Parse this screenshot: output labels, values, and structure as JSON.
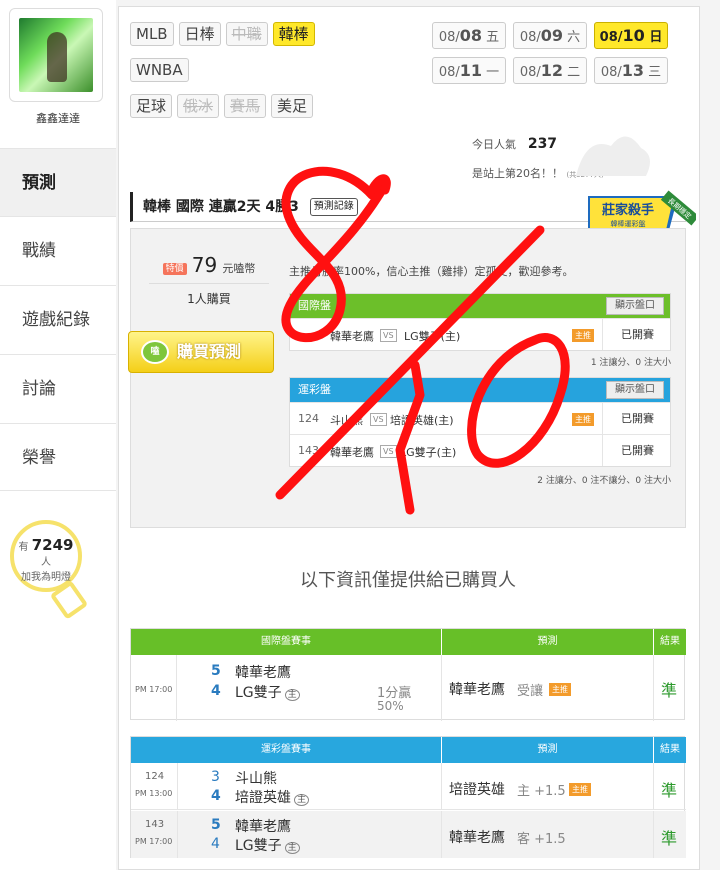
{
  "user": {
    "name": "鑫鑫達達"
  },
  "nav": [
    {
      "label": "預測",
      "active": true
    },
    {
      "label": "戰績"
    },
    {
      "label": "遊戲紀錄"
    },
    {
      "label": "討論"
    },
    {
      "label": "榮譽"
    }
  ],
  "fans": {
    "prefix": "有",
    "count": "7249",
    "unit": "人",
    "text": "加我為明燈"
  },
  "sports": {
    "row1": [
      {
        "label": "MLB"
      },
      {
        "label": "日棒"
      },
      {
        "label": "中職",
        "disabled": true
      },
      {
        "label": "韓棒",
        "selected": true
      }
    ],
    "row2": [
      {
        "label": "WNBA"
      }
    ],
    "row3": [
      {
        "label": "足球"
      },
      {
        "label": "俄冰",
        "disabled": true
      },
      {
        "label": "賽馬",
        "disabled": true
      },
      {
        "label": "美足"
      }
    ]
  },
  "dates": [
    {
      "md": "08/",
      "d": "08",
      "w": "五"
    },
    {
      "md": "08/",
      "d": "09",
      "w": "六"
    },
    {
      "md": "08/",
      "d": "10",
      "w": "日",
      "selected": true
    },
    {
      "md": "08/",
      "d": "11",
      "w": "一"
    },
    {
      "md": "08/",
      "d": "12",
      "w": "二"
    },
    {
      "md": "08/",
      "d": "13",
      "w": "三"
    }
  ],
  "stats": {
    "popularity_label": "今日人氣",
    "popularity": "237",
    "rank_text": "是站上第20名！！",
    "rank_note": "(共5277人)"
  },
  "prediction_header": {
    "title": "韓棒 國際 連贏2天 4勝3",
    "record_btn": "預測記錄"
  },
  "badge": {
    "title": "莊家殺手",
    "sub": "韓棒運彩盤",
    "ribbon": "長期穩定"
  },
  "price": {
    "tag": "特價",
    "amount": "79",
    "unit": "元嗑幣",
    "buyers": "1人購買",
    "buy_button": "購買預測",
    "coin": "嗑"
  },
  "note": "主推月勝率100%，信心主推（雞排）定孤支，歡迎參考。",
  "intl_block": {
    "header": "國際盤",
    "show_btn": "顯示盤口",
    "rows": [
      {
        "id": "",
        "away": "韓華老鷹",
        "vs": "VS",
        "home": "LG雙子(主)",
        "tag": "主推",
        "status": "已開賽"
      }
    ],
    "summary": "1 注讓分、0 注大小"
  },
  "sport_block": {
    "header": "運彩盤",
    "show_btn": "顯示盤口",
    "rows": [
      {
        "id": "124",
        "away": "斗山熊",
        "vs": "VS",
        "home": "培證英雄(主)",
        "tag": "主推",
        "status": "已開賽"
      },
      {
        "id": "143",
        "away": "韓華老鷹",
        "vs": "VS",
        "home": "LG雙子(主)",
        "tag": "",
        "status": "已開賽"
      }
    ],
    "summary": "2 注讓分、0 注不讓分、0 注大小"
  },
  "purchaser_notice": "以下資訊僅提供給已購買人",
  "intl_table": {
    "col_event": "國際盤賽事",
    "col_pred": "預測",
    "col_result": "結果",
    "rows": [
      {
        "id": "",
        "time": "PM 17:00",
        "n1": "5",
        "t1": "韓華老鷹",
        "n2": "4",
        "t2": "LG雙子",
        "host": "主",
        "line": "1分贏",
        "pct": "50%",
        "pred_team": "韓華老鷹",
        "pred_extra": "受讓",
        "pred_tag": "主推",
        "result": "準"
      }
    ]
  },
  "sport_table": {
    "col_event": "運彩盤賽事",
    "col_pred": "預測",
    "col_result": "結果",
    "rows": [
      {
        "id": "124",
        "time": "PM 13:00",
        "n1": "3",
        "t1": "斗山熊",
        "n2": "4",
        "t2": "培證英雄",
        "host": "主",
        "pred_team": "培證英雄",
        "pred_extra": "主 +1.5",
        "pred_tag": "主推",
        "result": "準"
      },
      {
        "id": "143",
        "time": "PM 17:00",
        "n1": "5",
        "t1": "韓華老鷹",
        "n2": "4",
        "t2": "LG雙子",
        "host": "主",
        "pred_team": "韓華老鷹",
        "pred_extra": "客 +1.5",
        "pred_tag": "",
        "result": "準"
      }
    ]
  },
  "colors": {
    "accent_yellow": "#ffe82a",
    "green": "#67bf28",
    "blue": "#28a7de",
    "scribble": "#ff0000"
  }
}
